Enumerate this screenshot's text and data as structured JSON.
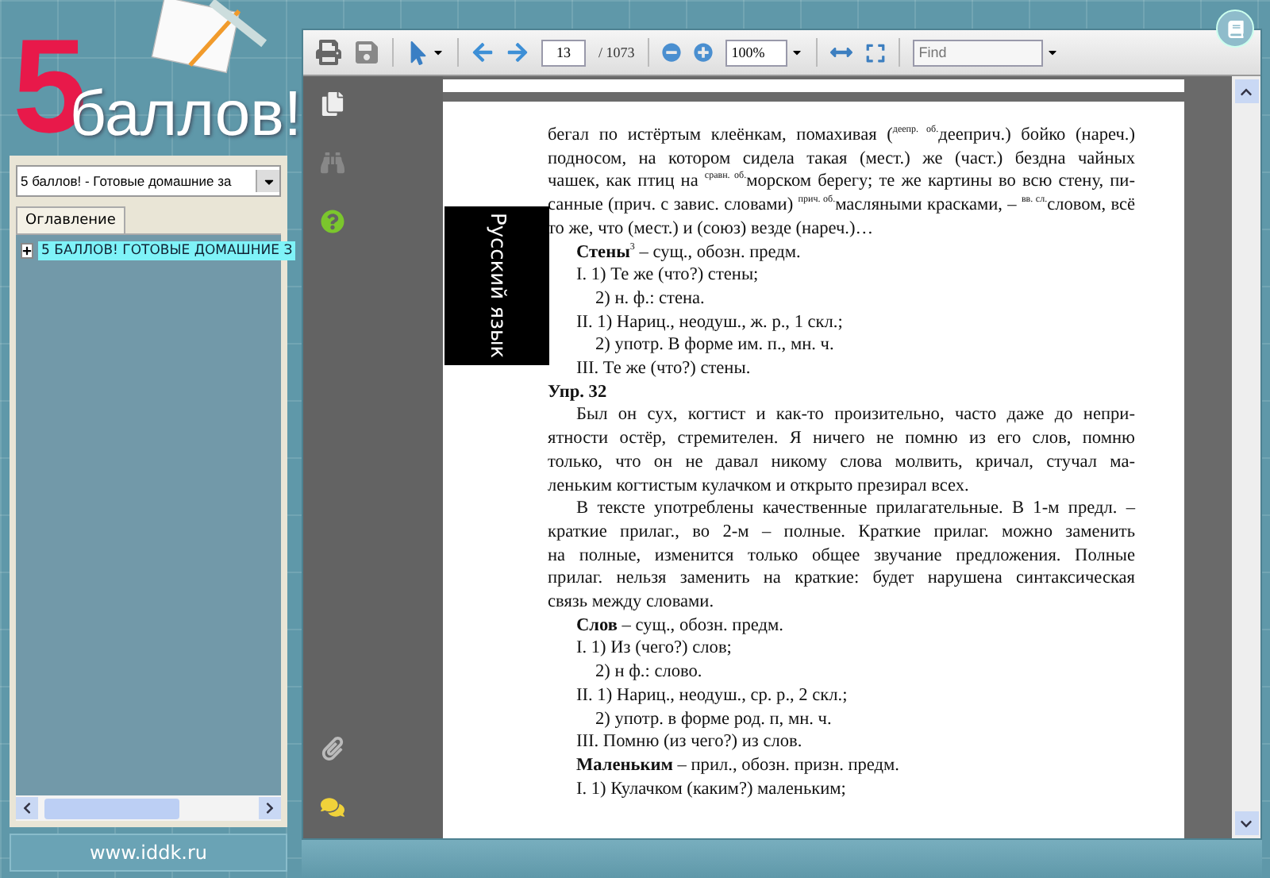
{
  "logo": {
    "digit": "5",
    "word": "баллов!"
  },
  "sidebar": {
    "book_select": {
      "value": "5 баллов! - Готовые домашние за"
    },
    "tabs": [
      {
        "label": "Оглавление",
        "selected": true
      }
    ],
    "tree": [
      {
        "label": "5 БАЛЛОВ! ГОТОВЫЕ ДОМАШНИЕ З",
        "expanded": false,
        "selected": true
      }
    ],
    "footer": "www.iddk.ru"
  },
  "toolbar": {
    "page": "13",
    "page_total": "/ 1073",
    "zoom": "100%",
    "find": {
      "placeholder": "Find"
    }
  },
  "side_tab": "Русский язык",
  "document": {
    "lines": [
      {
        "kind": "full",
        "text": "бегал по истёртым клеёнкам, помахивая ($^{деепр. об.}$дееприч.) бойко (нареч.)"
      },
      {
        "kind": "full",
        "text": "подносом, на котором сидела такая (мест.) же (част.) бездна чайных"
      },
      {
        "kind": "full",
        "text": "чашек, как птиц на $^{сравн. об.}$морском берегу; те же картины во всю стену, пи-"
      },
      {
        "kind": "full",
        "text": "санные (прич. с завис. словами) $^{прич. об.}$масляными красками, – $^{вв. сл.}$словом, всё"
      },
      {
        "kind": "end",
        "text": "то же, что (мест.) и (союз) везде (нареч.)…"
      },
      {
        "kind": "item",
        "text": "**Стены**$^{3}$ – сущ., обозн. предм."
      },
      {
        "kind": "item",
        "text": "I. 1) Те же (что?) стены;"
      },
      {
        "kind": "subitem",
        "text": "2) н. ф.: стена."
      },
      {
        "kind": "item",
        "text": "II. 1) Нариц., неодуш., ж. р., 1 скл.;"
      },
      {
        "kind": "subitem",
        "text": "2) употр. В форме им. п., мн. ч."
      },
      {
        "kind": "item",
        "text": "III. Те же (что?) стены."
      },
      {
        "kind": "heading",
        "text": "Упр. 32"
      },
      {
        "kind": "first",
        "text": "Был он сух, когтист и как-то произительно, часто даже до непри-"
      },
      {
        "kind": "full",
        "text": "ятности остёр, стремителен. Я ничего не помню из его слов, помню"
      },
      {
        "kind": "full",
        "text": "только, что он не давал никому слова молвить, кричал, стучал ма-"
      },
      {
        "kind": "end",
        "text": "леньким когтистым кулачком и открыто презирал всех."
      },
      {
        "kind": "first",
        "text": "В тексте употреблены качественные прилагательные. В 1-м предл. –"
      },
      {
        "kind": "full",
        "text": "краткие прилаг., во 2-м – полные. Краткие прилаг. можно заменить"
      },
      {
        "kind": "full",
        "text": "на полные, изменится только общее звучание предложения. Полные"
      },
      {
        "kind": "full",
        "text": "прилаг. нельзя заменить на краткие: будет нарушена синтаксическая"
      },
      {
        "kind": "end",
        "text": "связь между словами."
      },
      {
        "kind": "item",
        "text": "**Слов** – сущ., обозн. предм."
      },
      {
        "kind": "item",
        "text": "I. 1) Из (чего?) слов;"
      },
      {
        "kind": "subitem",
        "text": "2) н ф.: слово."
      },
      {
        "kind": "item",
        "text": "II. 1) Нариц., неодуш., ср. р., 2 скл.;"
      },
      {
        "kind": "subitem",
        "text": "2) употр. в форме род. п, мн. ч."
      },
      {
        "kind": "item",
        "text": "III. Помню (из чего?) из слов."
      },
      {
        "kind": "item",
        "text": "**Маленьким** – прил., обозн. призн. предм."
      },
      {
        "kind": "item",
        "text": "I. 1) Кулачком (каким?) маленьким;"
      }
    ]
  }
}
